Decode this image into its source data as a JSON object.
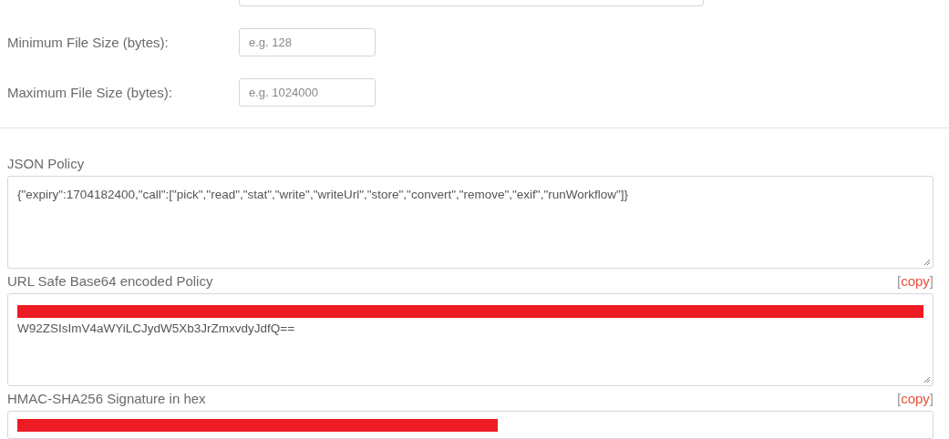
{
  "size_fields": [
    {
      "label": "Minimum File Size (bytes):",
      "placeholder": "e.g. 128"
    },
    {
      "label": "Maximum File Size (bytes):",
      "placeholder": "e.g. 1024000"
    }
  ],
  "policy_sections": [
    {
      "label": "JSON Policy",
      "kind": "textarea",
      "redacted": false,
      "value": "{\"expiry\":1704182400,\"call\":[\"pick\",\"read\",\"stat\",\"write\",\"writeUrl\",\"store\",\"convert\",\"remove\",\"exif\",\"runWorkflow\"]}"
    },
    {
      "label": "URL Safe Base64 encoded Policy",
      "kind": "textarea",
      "redacted": true,
      "copy": [
        "[",
        "copy",
        "]"
      ],
      "value": "W92ZSIsImV4aWYiLCJydW5Xb3JrZmxvdyJdfQ=="
    },
    {
      "label": "HMAC-SHA256 Signature in hex",
      "kind": "input",
      "redacted": true,
      "copy": [
        "[",
        "copy",
        "]"
      ]
    }
  ]
}
